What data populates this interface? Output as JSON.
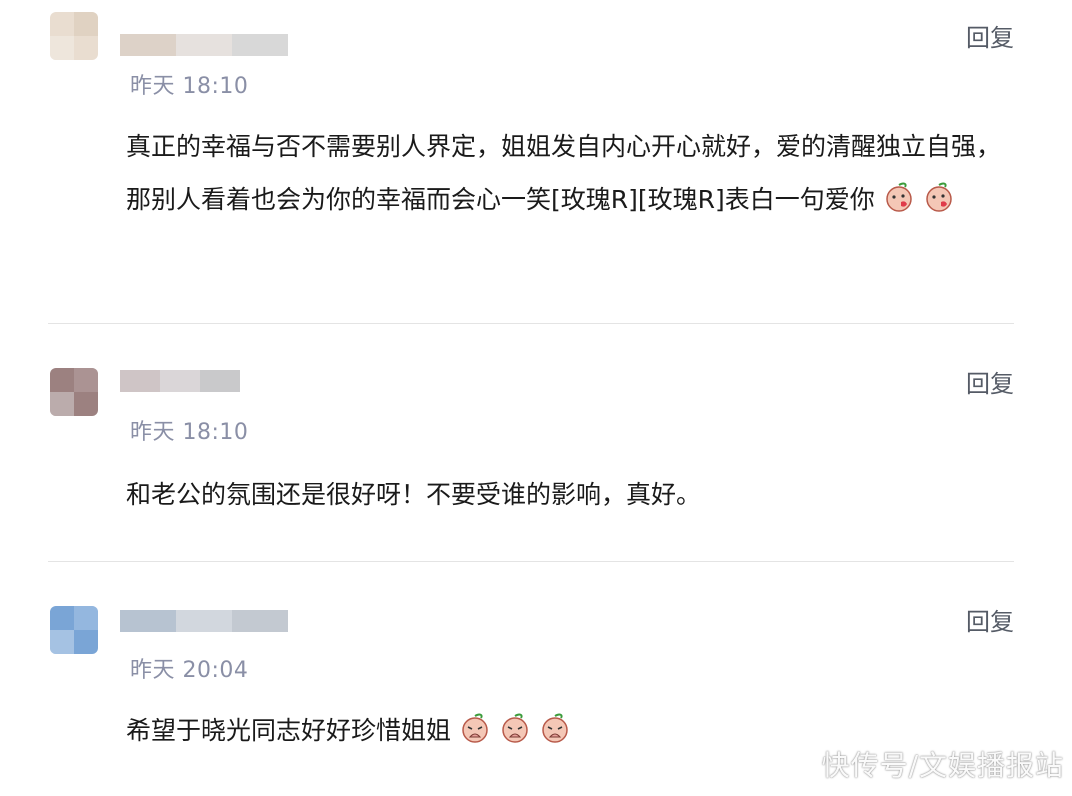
{
  "comments": [
    {
      "time": "昨天 18:10",
      "reply_label": "回复",
      "text": "真正的幸福与否不需要别人界定，姐姐发自内心开心就好，爱的清醒独立自强，那别人看着也会为你的幸福而会心一笑[玫瑰R][玫瑰R]表白一句爱你",
      "emoji": [
        "kiss-face-icon",
        "kiss-face-icon"
      ],
      "avatar_colors": [
        "#e9ddd0",
        "#d9c8b6",
        "#f3ede6"
      ],
      "nick_colors": [
        "#ddd2c8",
        "#e6e1de",
        "#d8d8d8"
      ]
    },
    {
      "time": "昨天 18:10",
      "reply_label": "回复",
      "text": "和老公的氛围还是很好呀！不要受谁的影响，真好。",
      "emoji": [],
      "avatar_colors": [
        "#9c8180",
        "#b8a3a3",
        "#d6cfd0"
      ],
      "nick_colors": [
        "#cfc5c6",
        "#dad6d8",
        "#c9c9cb"
      ]
    },
    {
      "time": "昨天 20:04",
      "reply_label": "回复",
      "text": "希望于晓光同志好好珍惜姐姐",
      "emoji": [
        "sad-face-icon",
        "sad-face-icon",
        "sad-face-icon"
      ],
      "avatar_colors": [
        "#7aa5d6",
        "#a9c6e8",
        "#c9daef"
      ],
      "nick_colors": [
        "#b7c3d1",
        "#d2d7de",
        "#c3c9d1"
      ]
    }
  ],
  "watermark": "快传号/文娱播报站",
  "colors": {
    "time": "#8a8fa6",
    "reply": "#555b66",
    "divider": "#e4e4e4"
  }
}
